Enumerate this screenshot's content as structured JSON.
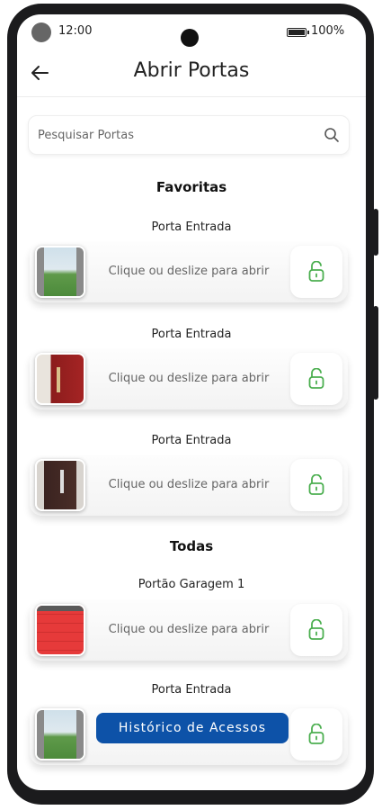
{
  "status_bar": {
    "time": "12:00",
    "battery": "100%"
  },
  "header": {
    "title": "Abrir Portas"
  },
  "search": {
    "placeholder": "Pesquisar Portas"
  },
  "sections": {
    "favorites": "Favoritas",
    "all": "Todas"
  },
  "doors": [
    {
      "name": "Porta Entrada",
      "hint": "Clique ou deslize para abrir",
      "image": "field-gate"
    },
    {
      "name": "Porta Entrada",
      "hint": "Clique ou deslize para abrir",
      "image": "red-door"
    },
    {
      "name": "Porta Entrada",
      "hint": "Clique ou deslize para abrir",
      "image": "brown-door"
    },
    {
      "name": "Portão Garagem 1",
      "hint": "Clique ou deslize para abrir",
      "image": "red-garage-door"
    },
    {
      "name": "Porta Entrada",
      "hint": "",
      "image": "field-gate"
    }
  ],
  "history_button": {
    "label": "Histórico de Acessos"
  },
  "colors": {
    "accent_green": "#4caf50",
    "history_blue": "#0d52a8"
  },
  "icons": [
    "back-arrow-icon",
    "search-icon",
    "unlock-icon",
    "battery-icon",
    "camera"
  ]
}
